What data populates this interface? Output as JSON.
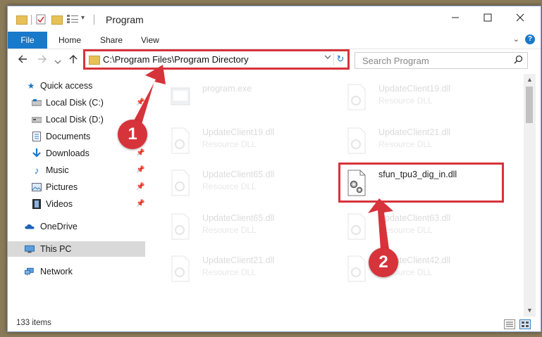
{
  "window": {
    "title": "Program",
    "tabs": [
      "File",
      "Home",
      "Share",
      "View"
    ]
  },
  "nav": {
    "address": "C:\\Program Files\\Program Directory",
    "search_placeholder": "Search Program"
  },
  "sidebar": {
    "items": [
      {
        "label": "Quick access",
        "icon": "star-icon"
      },
      {
        "label": "Local Disk (C:)",
        "icon": "drive-icon",
        "pinned": true
      },
      {
        "label": "Local Disk (D:)",
        "icon": "drive-icon"
      },
      {
        "label": "Documents",
        "icon": "documents-icon",
        "pinned": true
      },
      {
        "label": "Downloads",
        "icon": "download-arrow-icon",
        "pinned": true
      },
      {
        "label": "Music",
        "icon": "music-note-icon",
        "pinned": true
      },
      {
        "label": "Pictures",
        "icon": "pictures-icon",
        "pinned": true
      },
      {
        "label": "Videos",
        "icon": "videos-icon",
        "pinned": true
      },
      {
        "label": "OneDrive",
        "icon": "cloud-icon"
      },
      {
        "label": "This PC",
        "icon": "monitor-icon",
        "selected": true
      },
      {
        "label": "Network",
        "icon": "network-icon"
      }
    ]
  },
  "files": [
    {
      "name": "program.exe",
      "type": "",
      "icon": "exe-icon"
    },
    {
      "name": "UpdateClient19.dll",
      "type": "Resource DLL",
      "icon": "dll-icon"
    },
    {
      "name": "UpdateClient19.dll",
      "type": "Resource DLL",
      "icon": "dll-icon"
    },
    {
      "name": "UpdateClient21.dll",
      "type": "Resource DLL",
      "icon": "dll-icon"
    },
    {
      "name": "UpdateClient65.dll",
      "type": "Resource DLL",
      "icon": "dll-icon"
    },
    {
      "name": "sfun_tpu3_dig_in.dll",
      "type": "",
      "icon": "dll-gear-icon",
      "highlighted": true
    },
    {
      "name": "UpdateClient65.dll",
      "type": "Resource DLL",
      "icon": "dll-icon"
    },
    {
      "name": "UpdateClient63.dll",
      "type": "Resource DLL",
      "icon": "dll-icon"
    },
    {
      "name": "UpdateClient21.dll",
      "type": "Resource DLL",
      "icon": "dll-icon"
    },
    {
      "name": "UpdateClient42.dll",
      "type": "Resource DLL",
      "icon": "dll-icon"
    }
  ],
  "status": {
    "item_count": "133 items"
  },
  "callouts": [
    "1",
    "2"
  ],
  "colors": {
    "accent": "#1979ca",
    "highlight": "#d7333b"
  }
}
